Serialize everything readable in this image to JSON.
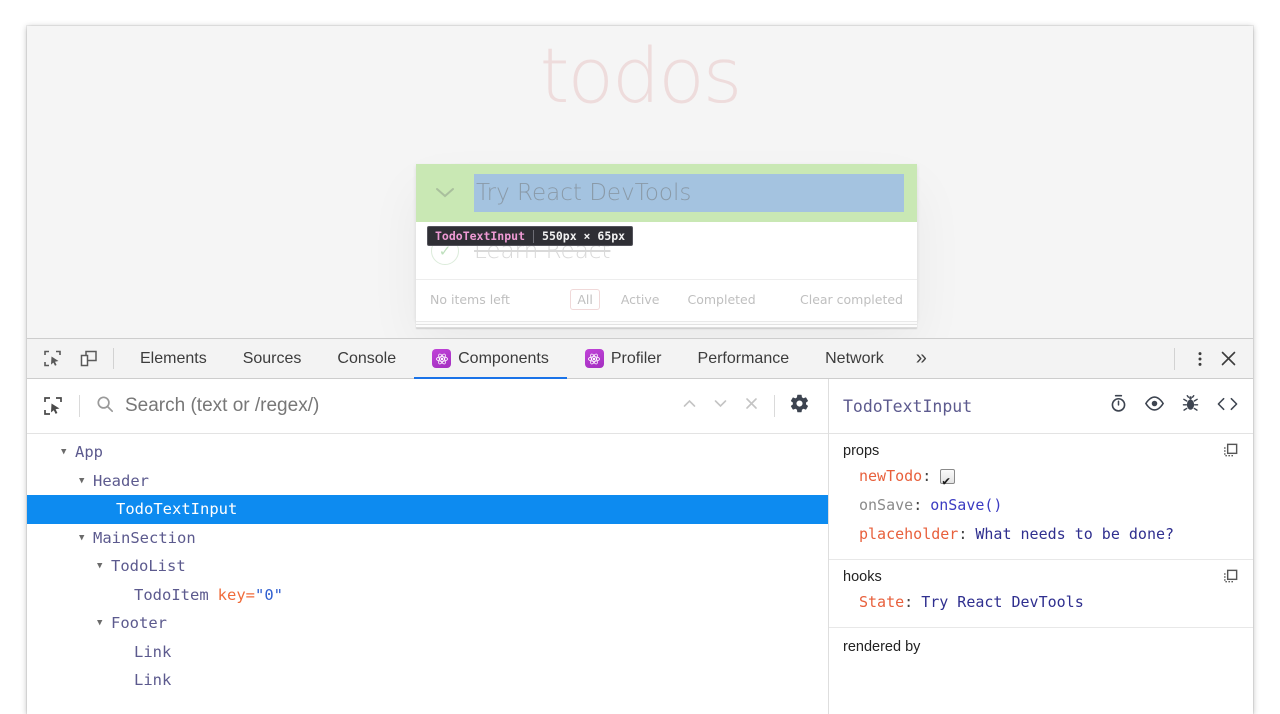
{
  "app": {
    "title": "todos",
    "toggle_all_icon": "chevron-down-icon",
    "new_todo_value": "Try React DevTools",
    "inspect_badge": {
      "component": "TodoTextInput",
      "dimensions": "550px × 65px"
    },
    "todo_items": [
      {
        "label": "Learn React",
        "completed": true,
        "check_icon": "check-icon"
      }
    ],
    "footer": {
      "count": "No items left",
      "filters": [
        {
          "label": "All",
          "selected": true
        },
        {
          "label": "Active",
          "selected": false
        },
        {
          "label": "Completed",
          "selected": false
        }
      ],
      "clear": "Clear completed"
    }
  },
  "devtools": {
    "tool_icons": [
      {
        "name": "inspect-element-icon"
      },
      {
        "name": "device-toolbar-icon"
      }
    ],
    "tabs": [
      {
        "label": "Elements",
        "active": false,
        "icon": null
      },
      {
        "label": "Sources",
        "active": false,
        "icon": null
      },
      {
        "label": "Console",
        "active": false,
        "icon": null
      },
      {
        "label": "Components",
        "active": true,
        "icon": "react-icon"
      },
      {
        "label": "Profiler",
        "active": false,
        "icon": "react-icon"
      },
      {
        "label": "Performance",
        "active": false,
        "icon": null
      },
      {
        "label": "Network",
        "active": false,
        "icon": null
      }
    ],
    "overflow_label": "»",
    "more_icon": "kebab-menu-icon",
    "close_icon": "close-icon"
  },
  "components_panel": {
    "select_element_icon": "select-element-icon",
    "search": {
      "icon": "search-icon",
      "value": "",
      "placeholder": "Search (text or /regex/)"
    },
    "nav": {
      "prev_icon": "chevron-up-icon",
      "next_icon": "chevron-down-icon",
      "clear_icon": "close-icon"
    },
    "settings_icon": "gear-icon",
    "tree": [
      {
        "label": "App",
        "depth": 0,
        "arrow": true,
        "selected": false
      },
      {
        "label": "Header",
        "depth": 1,
        "arrow": true,
        "selected": false
      },
      {
        "label": "TodoTextInput",
        "depth": 2,
        "arrow": false,
        "selected": true
      },
      {
        "label": "MainSection",
        "depth": 1,
        "arrow": true,
        "selected": false
      },
      {
        "label": "TodoList",
        "depth": 2,
        "arrow": true,
        "selected": false
      },
      {
        "label": "TodoItem",
        "depth": 3,
        "arrow": false,
        "selected": false,
        "attr_key": "key",
        "attr_value": "\"0\""
      },
      {
        "label": "Footer",
        "depth": 2,
        "arrow": true,
        "selected": false
      },
      {
        "label": "Link",
        "depth": 3,
        "arrow": false,
        "selected": false
      },
      {
        "label": "Link",
        "depth": 3,
        "arrow": false,
        "selected": false
      }
    ]
  },
  "inspector": {
    "component_name": "TodoTextInput",
    "actions": [
      {
        "name": "timer-icon"
      },
      {
        "name": "eye-icon"
      },
      {
        "name": "bug-icon"
      },
      {
        "name": "code-icon"
      }
    ],
    "props_section": {
      "title": "props",
      "copy_icon": "copy-to-clipboard-icon",
      "rows": [
        {
          "key": "newTodo",
          "dim": false,
          "type": "checkbox",
          "value": "true"
        },
        {
          "key": "onSave",
          "dim": true,
          "type": "function",
          "value": "onSave()"
        },
        {
          "key": "placeholder",
          "dim": false,
          "type": "string",
          "value": "What needs to be done?"
        }
      ]
    },
    "hooks_section": {
      "title": "hooks",
      "copy_icon": "copy-to-clipboard-icon",
      "rows": [
        {
          "key": "State",
          "dim": false,
          "type": "string",
          "value": "Try React DevTools"
        }
      ]
    },
    "rendered_by_title": "rendered by"
  },
  "colors": {
    "selection_blue": "#0d8bf0",
    "inspect_green": "#c9e8b4",
    "inspect_blue": "#a4c3e0",
    "react_purple": "#a32fc0",
    "active_tab_underline": "#1a73e8",
    "prop_key_orange": "#e8603c",
    "component_name_purple": "#5c5a8e"
  }
}
